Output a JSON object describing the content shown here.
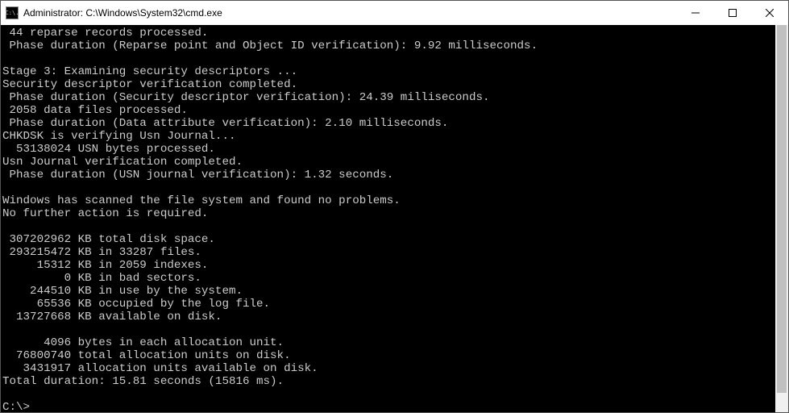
{
  "window": {
    "title": "Administrator: C:\\Windows\\System32\\cmd.exe",
    "icon_label": "C:\\."
  },
  "terminal": {
    "lines": [
      " 44 reparse records processed.",
      " Phase duration (Reparse point and Object ID verification): 9.92 milliseconds.",
      "",
      "Stage 3: Examining security descriptors ...",
      "Security descriptor verification completed.",
      " Phase duration (Security descriptor verification): 24.39 milliseconds.",
      " 2058 data files processed.",
      " Phase duration (Data attribute verification): 2.10 milliseconds.",
      "CHKDSK is verifying Usn Journal...",
      "  53138024 USN bytes processed.",
      "Usn Journal verification completed.",
      " Phase duration (USN journal verification): 1.32 seconds.",
      "",
      "Windows has scanned the file system and found no problems.",
      "No further action is required.",
      "",
      " 307202962 KB total disk space.",
      " 293215472 KB in 33287 files.",
      "     15312 KB in 2059 indexes.",
      "         0 KB in bad sectors.",
      "    244510 KB in use by the system.",
      "     65536 KB occupied by the log file.",
      "  13727668 KB available on disk.",
      "",
      "      4096 bytes in each allocation unit.",
      "  76800740 total allocation units on disk.",
      "   3431917 allocation units available on disk.",
      "Total duration: 15.81 seconds (15816 ms).",
      ""
    ],
    "prompt": "C:\\>"
  }
}
